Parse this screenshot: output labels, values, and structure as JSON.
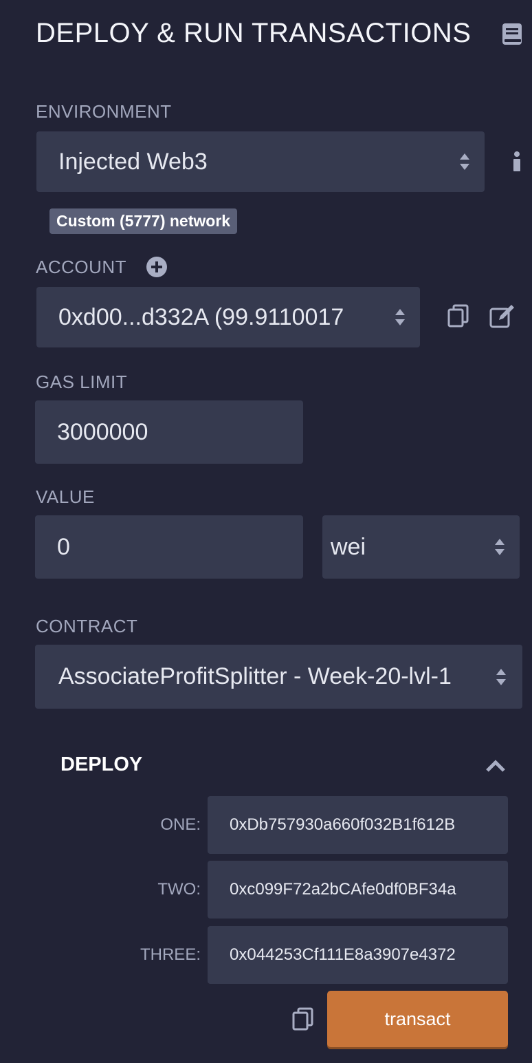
{
  "header": {
    "title": "DEPLOY & RUN TRANSACTIONS",
    "doc_icon": "book-icon"
  },
  "environment": {
    "label": "ENVIRONMENT",
    "selected": "Injected Web3",
    "network_badge": "Custom (5777) network",
    "info_icon": "info-icon"
  },
  "account": {
    "label": "ACCOUNT",
    "add_icon": "plus-circle-icon",
    "selected": "0xd00...d332A (99.9110017",
    "copy_icon": "copy-icon",
    "edit_icon": "edit-icon"
  },
  "gas_limit": {
    "label": "GAS LIMIT",
    "value": "3000000"
  },
  "value": {
    "label": "VALUE",
    "amount": "0",
    "unit": "wei"
  },
  "contract": {
    "label": "CONTRACT",
    "selected": "AssociateProfitSplitter - Week-20-lvl-1"
  },
  "deploy": {
    "title": "DEPLOY",
    "collapse_icon": "chevron-up-icon",
    "params": [
      {
        "label": "ONE:",
        "value": "0xDb757930a660f032B1f612B"
      },
      {
        "label": "TWO:",
        "value": "0xc099F72a2bCAfe0df0BF34a"
      },
      {
        "label": "THREE:",
        "value": "0x044253Cf111E8a3907e4372"
      }
    ],
    "copy_icon": "copy-icon",
    "transact_label": "transact"
  },
  "colors": {
    "background": "#222336",
    "field": "#363a4f",
    "accent": "#c97539",
    "badge": "#5a5f77"
  }
}
